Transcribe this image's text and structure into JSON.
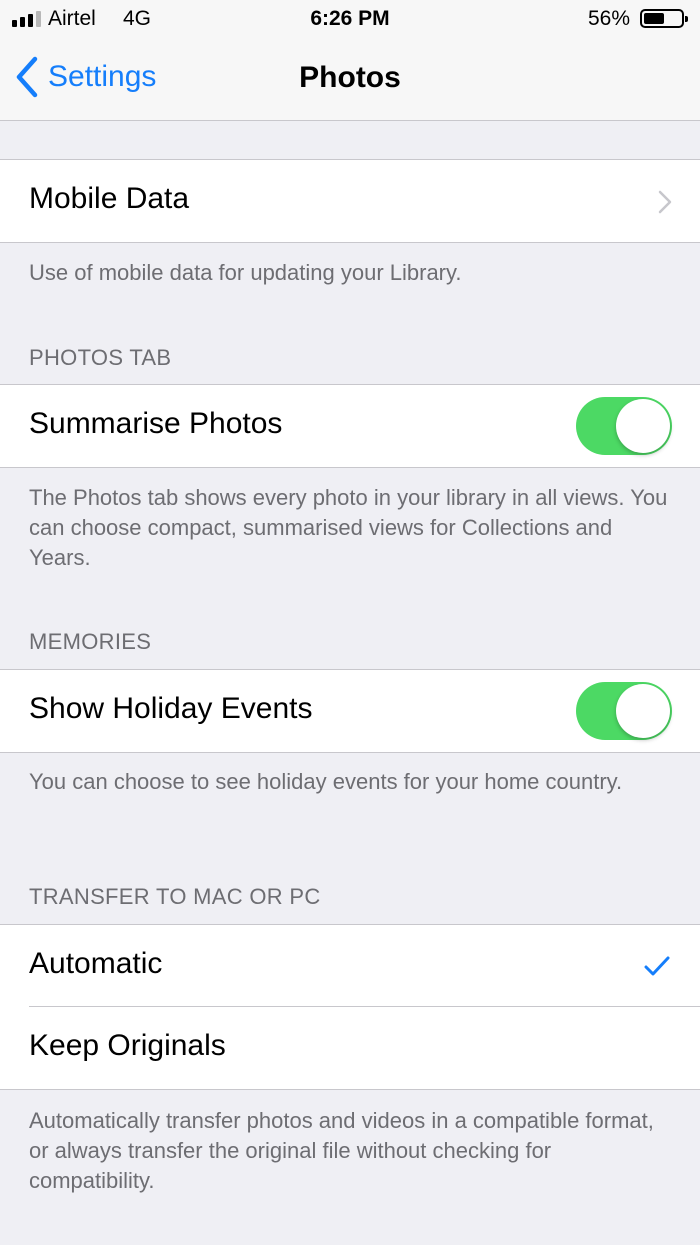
{
  "status_bar": {
    "carrier": "Airtel",
    "network": "4G",
    "time": "6:26 PM",
    "battery_percent": "56%",
    "battery_level": 0.56,
    "signal_bars_filled": 3,
    "signal_bars_total": 4
  },
  "nav": {
    "back_label": "Settings",
    "title": "Photos"
  },
  "mobile_data": {
    "label": "Mobile Data",
    "footer": "Use of mobile data for updating your Library."
  },
  "photos_tab": {
    "header": "PHOTOS TAB",
    "summarise_label": "Summarise Photos",
    "summarise_on": true,
    "footer": "The Photos tab shows every photo in your library in all views. You can choose compact, summarised views for Collections and Years."
  },
  "memories": {
    "header": "MEMORIES",
    "holiday_label": "Show Holiday Events",
    "holiday_on": true,
    "footer": "You can choose to see holiday events for your home country."
  },
  "transfer": {
    "header": "TRANSFER TO MAC OR PC",
    "options": [
      {
        "label": "Automatic",
        "selected": true
      },
      {
        "label": "Keep Originals",
        "selected": false
      }
    ],
    "footer": "Automatically transfer photos and videos in a compatible format, or always transfer the original file without checking for compatibility."
  },
  "colors": {
    "accent": "#157efb",
    "toggle_on": "#4cd964",
    "background": "#efeff4",
    "secondary_text": "#6d6d72"
  }
}
